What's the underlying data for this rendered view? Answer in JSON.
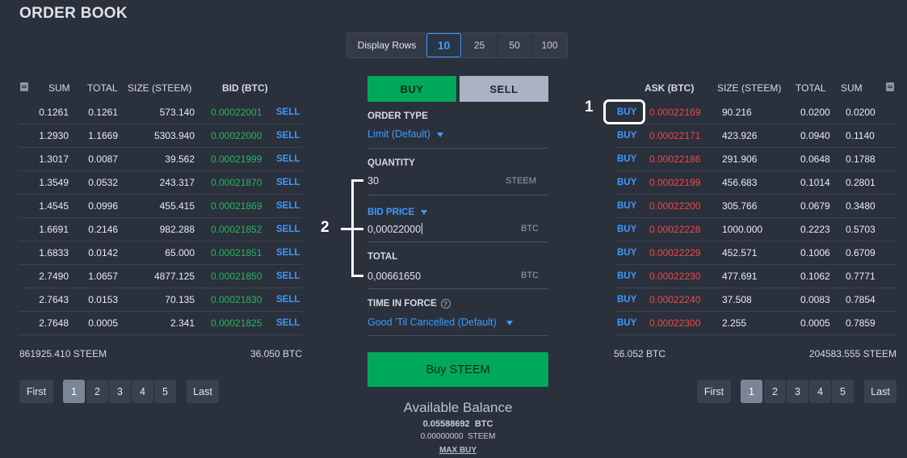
{
  "page": {
    "title": "ORDER BOOK"
  },
  "display_rows": {
    "label": "Display Rows",
    "options": [
      "10",
      "25",
      "50",
      "100"
    ],
    "selected": "10"
  },
  "bids": {
    "headers": {
      "sum": "SUM",
      "total": "TOTAL",
      "size": "SIZE (STEEM)",
      "bid": "BID (BTC)"
    },
    "action": "SELL",
    "rows": [
      {
        "sum": "0.1261",
        "total": "0.1261",
        "size": "573.140",
        "price": "0.00022001"
      },
      {
        "sum": "1.2930",
        "total": "1.1669",
        "size": "5303.940",
        "price": "0.00022000"
      },
      {
        "sum": "1.3017",
        "total": "0.0087",
        "size": "39.562",
        "price": "0.00021999"
      },
      {
        "sum": "1.3549",
        "total": "0.0532",
        "size": "243.317",
        "price": "0.00021870"
      },
      {
        "sum": "1.4545",
        "total": "0.0996",
        "size": "455.415",
        "price": "0.00021869"
      },
      {
        "sum": "1.6691",
        "total": "0.2146",
        "size": "982.288",
        "price": "0.00021852"
      },
      {
        "sum": "1.6833",
        "total": "0.0142",
        "size": "65.000",
        "price": "0.00021851"
      },
      {
        "sum": "2.7490",
        "total": "1.0657",
        "size": "4877.125",
        "price": "0.00021850"
      },
      {
        "sum": "2.7643",
        "total": "0.0153",
        "size": "70.135",
        "price": "0.00021830"
      },
      {
        "sum": "2.7648",
        "total": "0.0005",
        "size": "2.341",
        "price": "0.00021825"
      }
    ],
    "footer_left": "861925.410 STEEM",
    "footer_right": "36.050 BTC"
  },
  "asks": {
    "headers": {
      "ask": "ASK (BTC)",
      "size": "SIZE (STEEM)",
      "total": "TOTAL",
      "sum": "SUM"
    },
    "action": "BUY",
    "rows": [
      {
        "price": "0.00022169",
        "size": "90.216",
        "total": "0.0200",
        "sum": "0.0200"
      },
      {
        "price": "0.00022171",
        "size": "423.926",
        "total": "0.0940",
        "sum": "0.1140"
      },
      {
        "price": "0.00022186",
        "size": "291.906",
        "total": "0.0648",
        "sum": "0.1788"
      },
      {
        "price": "0.00022199",
        "size": "456.683",
        "total": "0.1014",
        "sum": "0.2801"
      },
      {
        "price": "0.00022200",
        "size": "305.766",
        "total": "0.0679",
        "sum": "0.3480"
      },
      {
        "price": "0.00022228",
        "size": "1000.000",
        "total": "0.2223",
        "sum": "0.5703"
      },
      {
        "price": "0.00022229",
        "size": "452.571",
        "total": "0.1006",
        "sum": "0.6709"
      },
      {
        "price": "0.00022230",
        "size": "477.691",
        "total": "0.1062",
        "sum": "0.7771"
      },
      {
        "price": "0.00022240",
        "size": "37.508",
        "total": "0.0083",
        "sum": "0.7854"
      },
      {
        "price": "0.00022300",
        "size": "2.255",
        "total": "0.0005",
        "sum": "0.7859"
      }
    ],
    "footer_left": "56.052 BTC",
    "footer_right": "204583.555 STEEM"
  },
  "pagination": {
    "first": "First",
    "pages": [
      "1",
      "2",
      "3",
      "4",
      "5"
    ],
    "selected": "1",
    "last": "Last"
  },
  "form": {
    "tabs": {
      "buy": "BUY",
      "sell": "SELL",
      "active": "BUY"
    },
    "order_type": {
      "label": "ORDER TYPE",
      "value": "Limit (Default)"
    },
    "quantity": {
      "label": "QUANTITY",
      "value": "30",
      "unit": "STEEM"
    },
    "bid_price": {
      "label": "BID PRICE",
      "value": "0,00022000",
      "unit": "BTC"
    },
    "total": {
      "label": "TOTAL",
      "value": "0,00661650",
      "unit": "BTC"
    },
    "time_in_force": {
      "label": "TIME IN FORCE",
      "value": "Good 'Til Cancelled (Default)"
    },
    "submit": "Buy STEEM"
  },
  "balance": {
    "title": "Available Balance",
    "btc_amount": "0.05588692",
    "btc_unit": "BTC",
    "steem_amount": "0.00000000",
    "steem_unit": "STEEM",
    "max_buy": "MAX BUY"
  },
  "annotations": {
    "one": "1",
    "two": "2"
  },
  "colors": {
    "bid": "#26b85d",
    "ask": "#f04848",
    "accent": "#3d9bff",
    "buy": "#00a859"
  }
}
